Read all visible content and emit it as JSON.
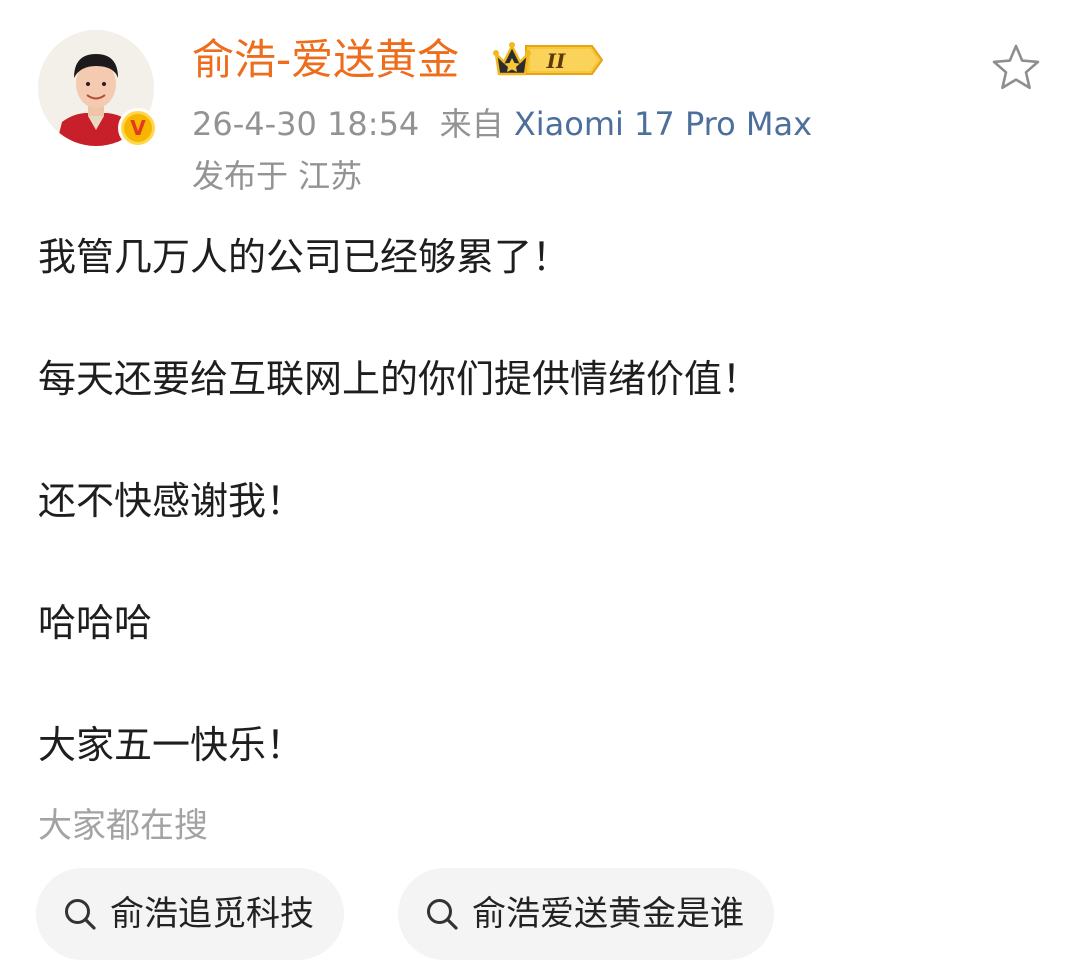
{
  "post": {
    "author": {
      "name": "俞浩-爱送黄金",
      "verified_mark": "V",
      "membership_level": "II"
    },
    "timestamp": "26-4-30 18:54",
    "source_prefix": "来自",
    "source_device": "Xiaomi 17 Pro Max",
    "location": "发布于 江苏",
    "content": [
      "我管几万人的公司已经够累了！",
      "每天还要给互联网上的你们提供情绪价值！",
      "还不快感谢我！",
      "哈哈哈",
      "大家五一快乐！"
    ]
  },
  "trending": {
    "title": "大家都在搜",
    "chips": [
      {
        "label": "俞浩追觅科技",
        "icon": "search-icon"
      },
      {
        "label": "俞浩爱送黄金是谁",
        "icon": "search-icon"
      }
    ]
  },
  "icons": {
    "favorite": "star-outline-icon",
    "verified": "verified-v-icon",
    "membership": "crown-badge-icon"
  },
  "colors": {
    "username": "#ee6d1c",
    "meta": "#939393",
    "source_link": "#4d6f9b",
    "body_text": "#1e1e1e",
    "chip_bg": "#f4f4f4",
    "verified_badge": "#f7b500"
  }
}
